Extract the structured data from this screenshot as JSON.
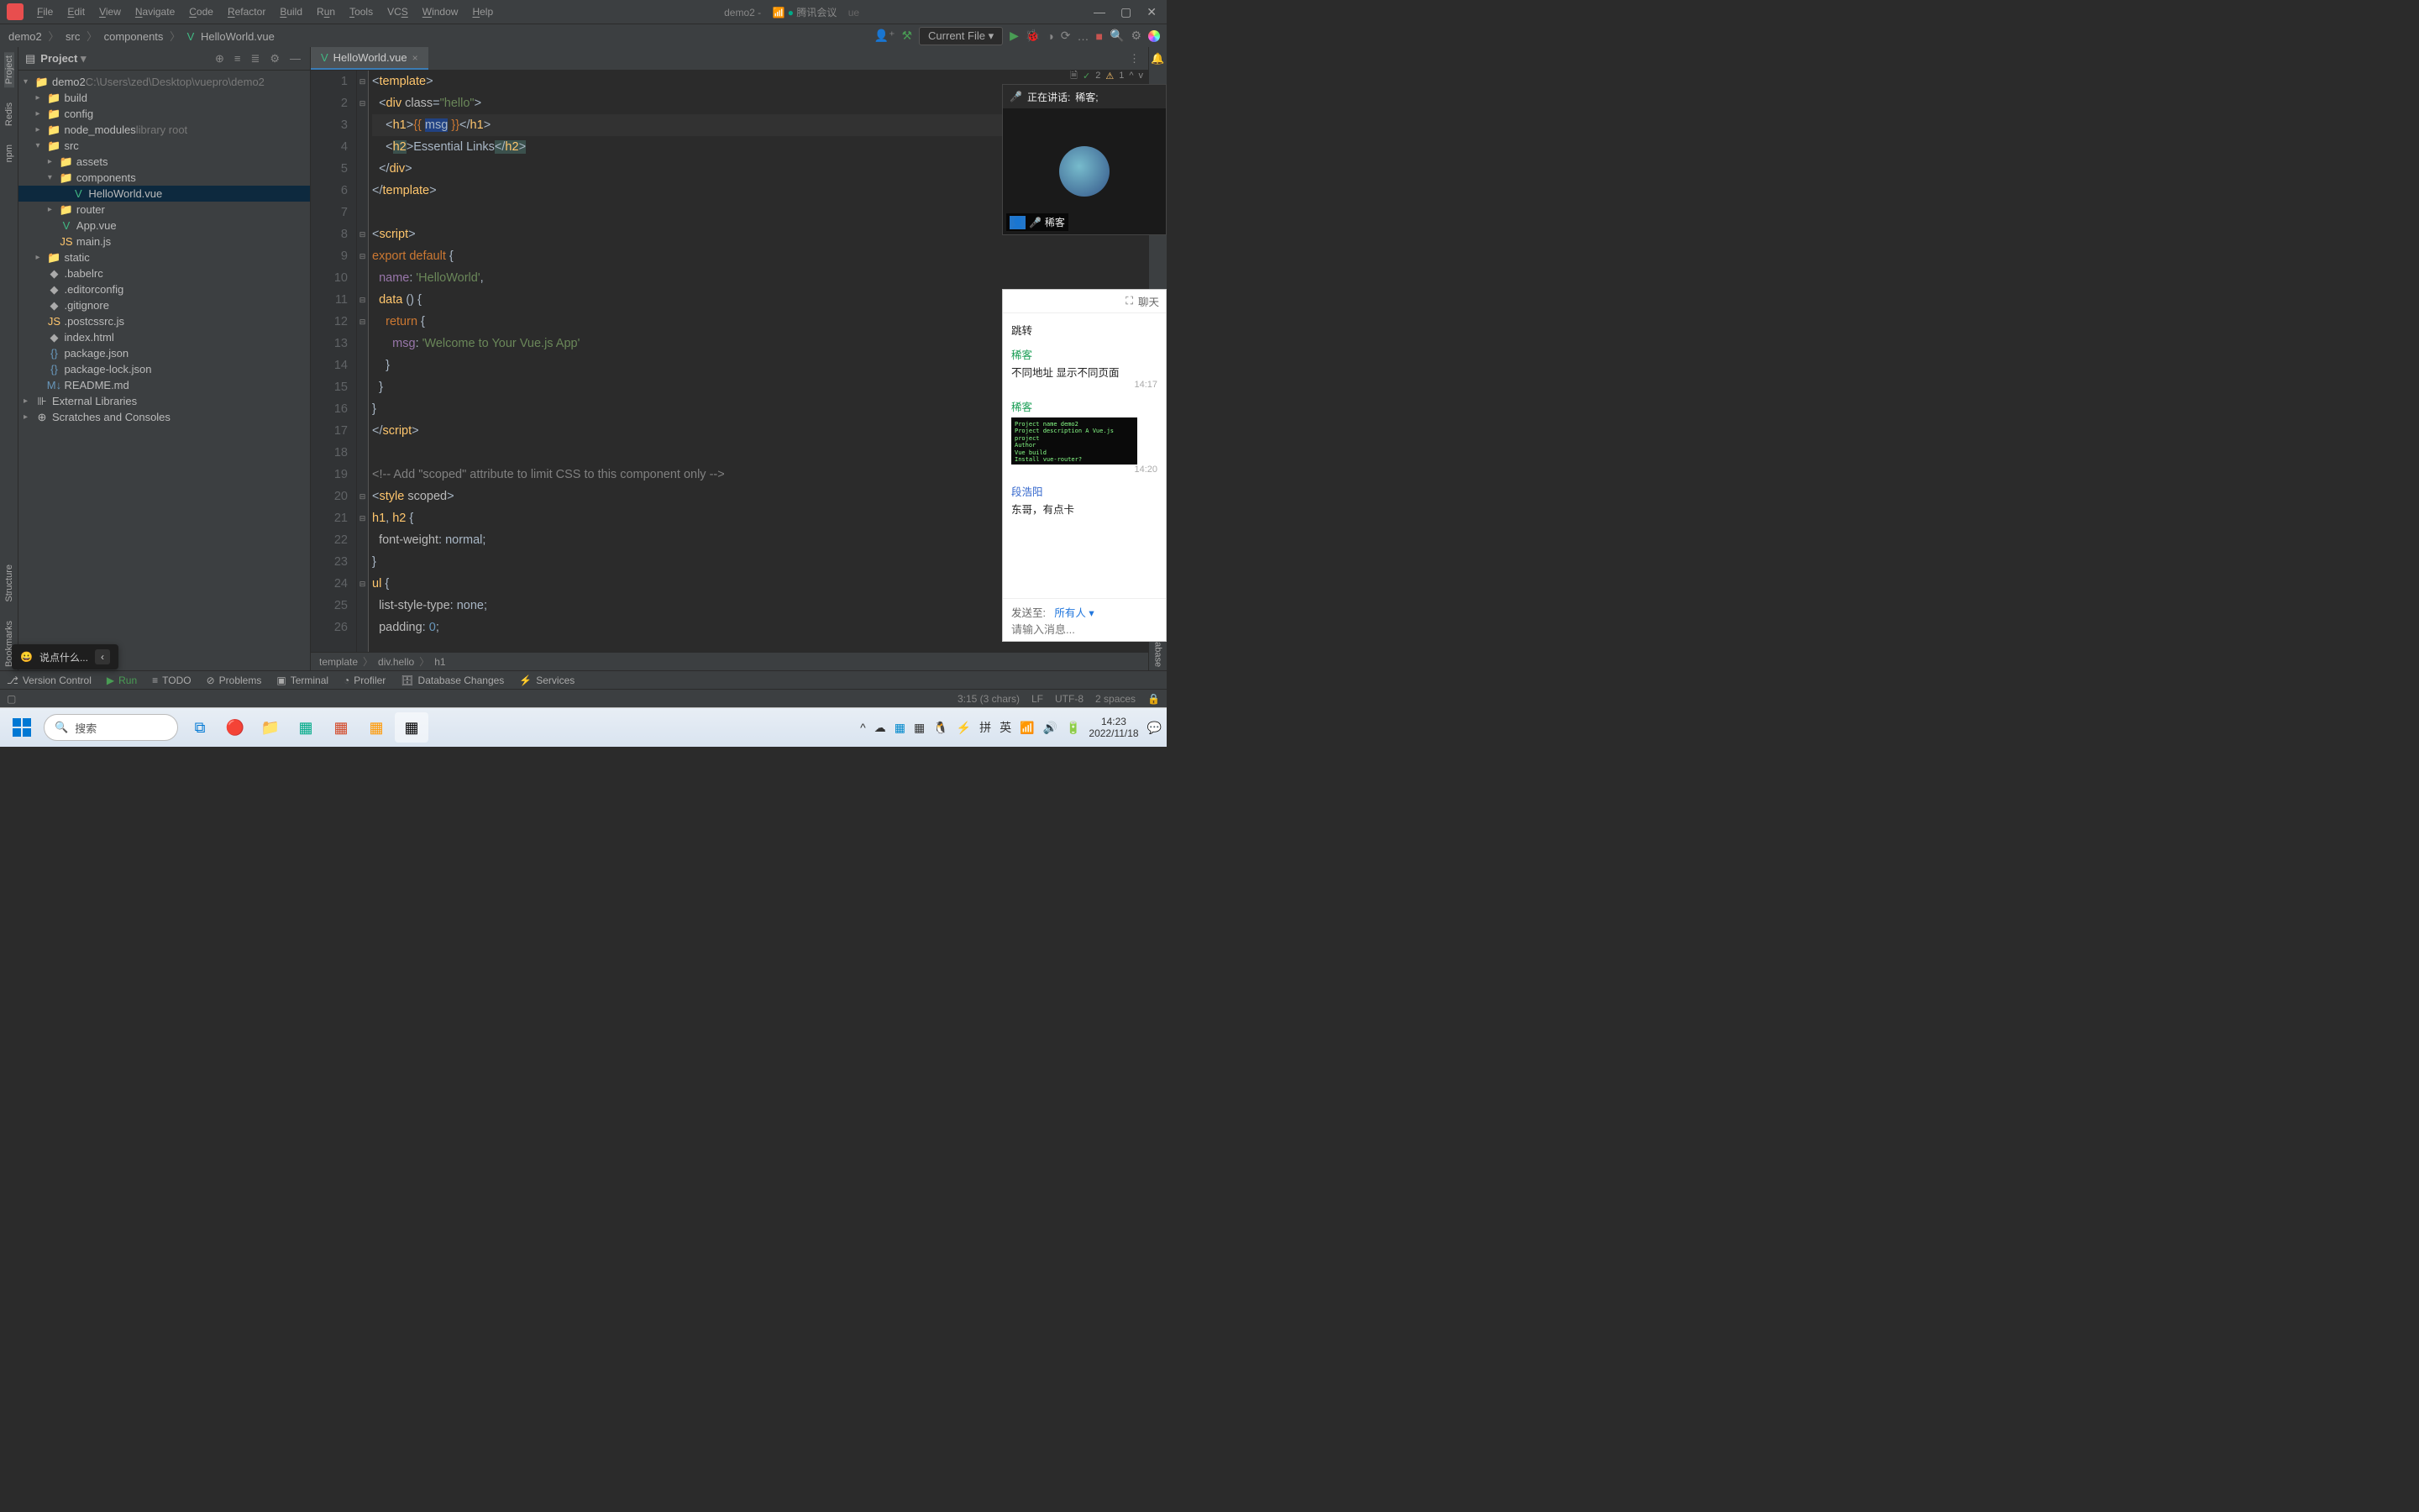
{
  "titlebar": {
    "menus": [
      "File",
      "Edit",
      "View",
      "Navigate",
      "Code",
      "Refactor",
      "Build",
      "Run",
      "Tools",
      "VCS",
      "Window",
      "Help"
    ],
    "project": "demo2",
    "meeting_app": "腾讯会议",
    "file_hint": "ue"
  },
  "breadcrumbs": [
    "demo2",
    "src",
    "components",
    "HelloWorld.vue"
  ],
  "runConfig": "Current File",
  "sidebar": {
    "title": "Project",
    "root": {
      "name": "demo2",
      "path": "C:\\Users\\zed\\Desktop\\vuepro\\demo2"
    },
    "tree": [
      {
        "indent": 1,
        "arrow": "▾",
        "icon": "dir",
        "name": "demo2",
        "hint": "C:\\Users\\zed\\Desktop\\vuepro\\demo2"
      },
      {
        "indent": 2,
        "arrow": "▸",
        "icon": "dir",
        "name": "build"
      },
      {
        "indent": 2,
        "arrow": "▸",
        "icon": "dir",
        "name": "config"
      },
      {
        "indent": 2,
        "arrow": "▸",
        "icon": "dir",
        "name": "node_modules",
        "hint": "library root"
      },
      {
        "indent": 2,
        "arrow": "▾",
        "icon": "dir",
        "name": "src"
      },
      {
        "indent": 3,
        "arrow": "▸",
        "icon": "dir",
        "name": "assets"
      },
      {
        "indent": 3,
        "arrow": "▾",
        "icon": "dir",
        "name": "components"
      },
      {
        "indent": 4,
        "arrow": "",
        "icon": "vue",
        "name": "HelloWorld.vue",
        "selected": true
      },
      {
        "indent": 3,
        "arrow": "▸",
        "icon": "dir",
        "name": "router"
      },
      {
        "indent": 3,
        "arrow": "",
        "icon": "vue",
        "name": "App.vue"
      },
      {
        "indent": 3,
        "arrow": "",
        "icon": "js",
        "name": "main.js"
      },
      {
        "indent": 2,
        "arrow": "▸",
        "icon": "dir",
        "name": "static"
      },
      {
        "indent": 2,
        "arrow": "",
        "icon": "generic",
        "name": ".babelrc"
      },
      {
        "indent": 2,
        "arrow": "",
        "icon": "generic",
        "name": ".editorconfig"
      },
      {
        "indent": 2,
        "arrow": "",
        "icon": "generic",
        "name": ".gitignore"
      },
      {
        "indent": 2,
        "arrow": "",
        "icon": "js",
        "name": ".postcssrc.js"
      },
      {
        "indent": 2,
        "arrow": "",
        "icon": "generic",
        "name": "index.html"
      },
      {
        "indent": 2,
        "arrow": "",
        "icon": "json",
        "name": "package.json"
      },
      {
        "indent": 2,
        "arrow": "",
        "icon": "json",
        "name": "package-lock.json"
      },
      {
        "indent": 2,
        "arrow": "",
        "icon": "md",
        "name": "README.md"
      },
      {
        "indent": 1,
        "arrow": "▸",
        "icon": "lib",
        "name": "External Libraries"
      },
      {
        "indent": 1,
        "arrow": "▸",
        "icon": "scratch",
        "name": "Scratches and Consoles"
      }
    ]
  },
  "leftRailTabs": [
    "Project",
    "Redis",
    "npm",
    "Structure",
    "Bookmarks"
  ],
  "rightRailTabs": [
    "Notifications",
    "Database"
  ],
  "tabs": [
    {
      "name": "HelloWorld.vue",
      "icon": "vue"
    }
  ],
  "editor": {
    "lines": 26,
    "highlightLine": 3,
    "inspections": "✓ 2 ⚠ 1 ^ v",
    "breadcrumb": [
      "template",
      "div.hello",
      "h1"
    ]
  },
  "code": {
    "l1": {
      "pre": "<",
      "tag": "template",
      "post": ">"
    },
    "l2": {
      "pre": "  <",
      "tag": "div",
      "attr": " class",
      "eq": "=",
      "str": "\"hello\"",
      "post": ">"
    },
    "l3": {
      "pre": "    <",
      "tag": "h1",
      "post": ">{{ ",
      "var": "msg",
      "post2": " }}</",
      "tag2": "h1",
      "post3": ">"
    },
    "l4": {
      "pre": "    <",
      "tag": "h2",
      "post": ">",
      "txt": "Essential Links",
      "pre2": "</",
      "tag2": "h2",
      "post2": ">"
    },
    "l5": {
      "pre": "  </",
      "tag": "div",
      "post": ">"
    },
    "l6": {
      "pre": "</",
      "tag": "template",
      "post": ">"
    },
    "l8": {
      "pre": "<",
      "tag": "script",
      "post": ">"
    },
    "l9": {
      "kw": "export default ",
      "brace": "{"
    },
    "l10": {
      "prop": "  name",
      "colon": ": ",
      "str": "'HelloWorld'",
      "comma": ","
    },
    "l11": {
      "fn": "  data ",
      "paren": "() {",
      "": ""
    },
    "l12": {
      "kw": "    return ",
      "brace": "{"
    },
    "l13": {
      "prop": "      msg",
      "colon": ": ",
      "str": "'Welcome to Your Vue.js App'"
    },
    "l14": "    }",
    "l15": "  }",
    "l16": "}",
    "l17": {
      "pre": "</",
      "tag": "script",
      "post": ">"
    },
    "l19": "<!-- Add \"scoped\" attribute to limit CSS to this component only -->",
    "l20": {
      "pre": "<",
      "tag": "style",
      "attr": " scoped",
      "post": ">"
    },
    "l21": {
      "sel": "h1",
      ", ": "",
      "sel2": "h2",
      " {": ""
    },
    "l22": {
      "prop": "  font-weight",
      "colon": ": ",
      "val": "normal",
      "semi": ";"
    },
    "l23": "}",
    "l24": {
      "sel": "ul",
      " {": ""
    },
    "l25": {
      "prop": "  list-style-type",
      "colon": ": ",
      "val": "none",
      "semi": ";"
    },
    "l26": {
      "prop": "  padding",
      "colon": ": ",
      "val": "0",
      "semi": ";"
    }
  },
  "bottombar": {
    "items": [
      "Version Control",
      "Run",
      "TODO",
      "Problems",
      "Terminal",
      "Profiler",
      "Database Changes",
      "Services"
    ]
  },
  "statusbar": {
    "pos": "3:15 (3 chars)",
    "sep": "LF",
    "enc": "UTF-8",
    "indent": "2 spaces"
  },
  "chatbubble": {
    "emoji": "😀",
    "text": "说点什么...",
    "close": "‹"
  },
  "meeting": {
    "speaking": "正在讲话:",
    "speaker": "稀客;",
    "participant": "稀客"
  },
  "chat": {
    "title": "聊天",
    "messages": [
      {
        "type": "text",
        "text": "跳转"
      },
      {
        "type": "msg",
        "user": "稀客",
        "userClass": "user-g",
        "text": "不同地址 显示不同页面",
        "time": "14:17"
      },
      {
        "type": "img",
        "user": "稀客",
        "userClass": "user-g",
        "imgText": "Project name demo2\nProject description A Vue.js project\nAuthor\nVue build\nInstall vue-router?",
        "time": "14:20"
      },
      {
        "type": "msg",
        "user": "段浩阳",
        "userClass": "user-b",
        "text": "东哥，有点卡"
      }
    ],
    "sendTo": "发送至:",
    "target": "所有人 ▾",
    "placeholder": "请输入消息..."
  },
  "taskbar": {
    "search": "搜索",
    "time": "14:23",
    "date": "2022/11/18",
    "ime1": "拼",
    "ime2": "英"
  }
}
